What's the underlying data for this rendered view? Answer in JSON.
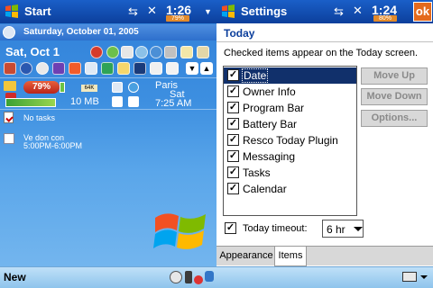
{
  "left": {
    "title": "Start",
    "time": "1:26",
    "battery_badge": "79%",
    "date_long": "Saturday, October 01, 2005",
    "date_short": "Sat, Oct 1",
    "battery_percent": "79%",
    "memory_label": "64K",
    "memory_value": "10 MB",
    "city": "Paris",
    "weekday": "Sat",
    "clock": "7:25 AM",
    "tasks_text": "No tasks",
    "appointment_title": "Ve don con",
    "appointment_time": "5:00PM-6:00PM",
    "menu_new": "New"
  },
  "right": {
    "title": "Settings",
    "time": "1:24",
    "battery_badge": "80%",
    "ok_label": "ok",
    "section": "Today",
    "instruction": "Checked items appear on the Today screen.",
    "items": [
      {
        "label": "Date",
        "checked": true,
        "selected": true
      },
      {
        "label": "Owner Info",
        "checked": true,
        "selected": false
      },
      {
        "label": "Program Bar",
        "checked": true,
        "selected": false
      },
      {
        "label": "Battery Bar",
        "checked": true,
        "selected": false
      },
      {
        "label": "Resco Today Plugin",
        "checked": true,
        "selected": false
      },
      {
        "label": "Messaging",
        "checked": true,
        "selected": false
      },
      {
        "label": "Tasks",
        "checked": true,
        "selected": false
      },
      {
        "label": "Calendar",
        "checked": true,
        "selected": false
      }
    ],
    "move_up": "Move Up",
    "move_down": "Move Down",
    "options": "Options...",
    "timeout_label": "Today timeout:",
    "timeout_checked": true,
    "timeout_value": "6 hr",
    "tabs": [
      "Appearance",
      "Items"
    ],
    "active_tab": "Items"
  }
}
